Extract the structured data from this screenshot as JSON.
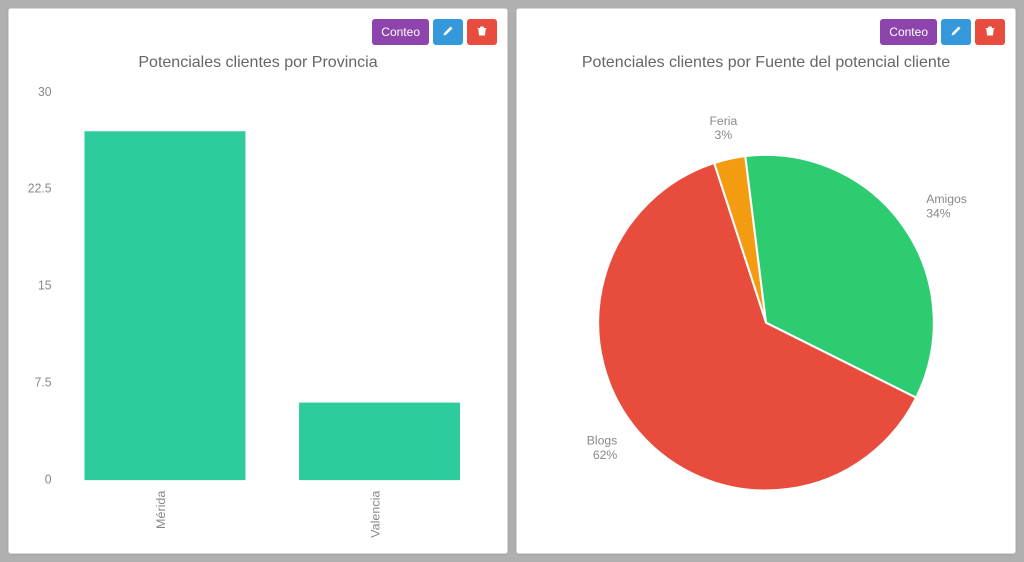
{
  "panel_bar": {
    "conteo_label": "Conteo",
    "title": "Potenciales clientes por Provincia"
  },
  "panel_pie": {
    "conteo_label": "Conteo",
    "title": "Potenciales clientes por Fuente del potencial cliente"
  },
  "chart_data": [
    {
      "type": "bar",
      "title": "Potenciales clientes por Provincia",
      "categories": [
        "Mérida",
        "Valencia"
      ],
      "values": [
        27,
        6
      ],
      "ylabel": "",
      "xlabel": "",
      "ylim": [
        0,
        30
      ],
      "yticks": [
        0,
        7.5,
        15,
        22.5,
        30
      ],
      "bar_color": "#2ecc9c"
    },
    {
      "type": "pie",
      "title": "Potenciales clientes por Fuente del potencial cliente",
      "slices": [
        {
          "name": "Feria",
          "percent": 3,
          "color": "#f39c12"
        },
        {
          "name": "Amigos",
          "percent": 34,
          "color": "#2ecc71"
        },
        {
          "name": "Blogs",
          "percent": 62,
          "color": "#e74c3c"
        }
      ]
    }
  ],
  "colors": {
    "btn_purple": "#8e44ad",
    "btn_blue": "#3498db",
    "btn_red": "#e74c3c"
  }
}
